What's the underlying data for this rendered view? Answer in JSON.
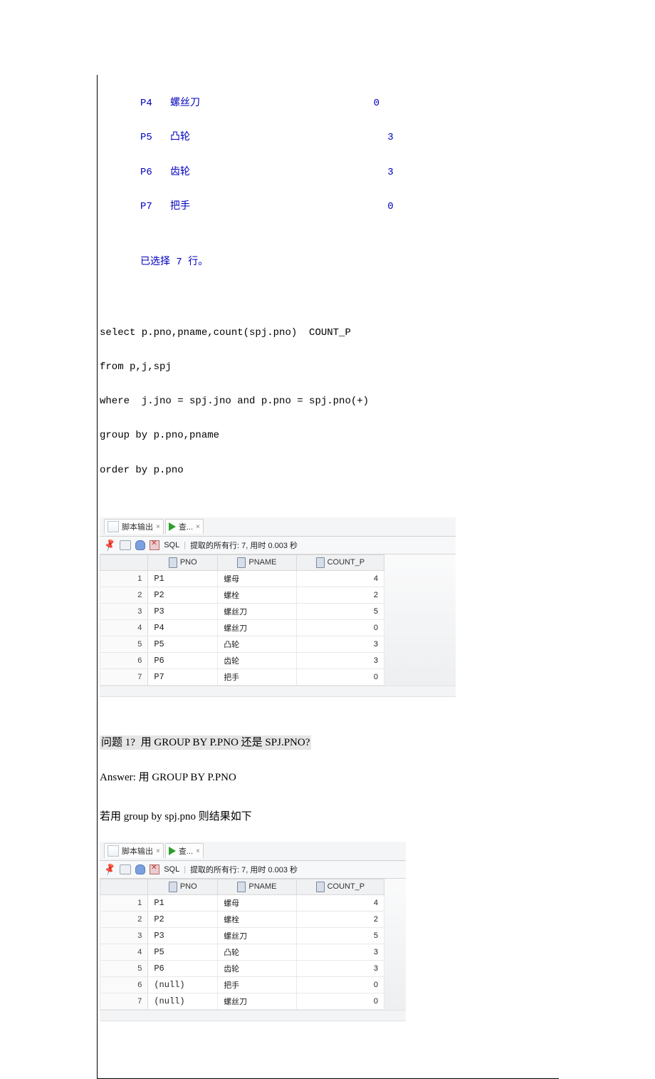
{
  "top_list": [
    {
      "pno": "P4",
      "pname": "螺丝刀",
      "count": "0"
    },
    {
      "pno": "P5",
      "pname": "凸轮",
      "count": "3"
    },
    {
      "pno": "P6",
      "pname": "齿轮",
      "count": "3"
    },
    {
      "pno": "P7",
      "pname": "把手",
      "count": "0"
    }
  ],
  "top_selected_text": "已选择 7 行。",
  "sql_lines": [
    "select p.pno,pname,count(spj.pno)  COUNT_P",
    "from p,j,spj",
    "where  j.jno = spj.jno and p.pno = spj.pno(+)",
    "group by p.pno,pname",
    "order by p.pno"
  ],
  "panel1": {
    "tab1_label": "脚本输出",
    "tab2_label": "查...",
    "sql_word": "SQL",
    "stats": "提取的所有行: 7, 用时 0.003 秒",
    "columns": {
      "pno": "PNO",
      "pname": "PNAME",
      "count": "COUNT_P"
    },
    "rows": [
      {
        "idx": "1",
        "pno": "P1",
        "pname": "螺母",
        "count": "4"
      },
      {
        "idx": "2",
        "pno": "P2",
        "pname": "螺栓",
        "count": "2"
      },
      {
        "idx": "3",
        "pno": "P3",
        "pname": "螺丝刀",
        "count": "5"
      },
      {
        "idx": "4",
        "pno": "P4",
        "pname": "螺丝刀",
        "count": "0"
      },
      {
        "idx": "5",
        "pno": "P5",
        "pname": "凸轮",
        "count": "3"
      },
      {
        "idx": "6",
        "pno": "P6",
        "pname": "齿轮",
        "count": "3"
      },
      {
        "idx": "7",
        "pno": "P7",
        "pname": "把手",
        "count": "0"
      }
    ]
  },
  "question": {
    "label_hl": "问题 1?",
    "label_rest": " 用 GROUP BY P.PNO 还是 SPJ.PNO?",
    "answer": "Answer:  用 GROUP BY P.PNO",
    "note": "若用 group by spj.pno 则结果如下"
  },
  "panel2": {
    "tab1_label": "脚本输出",
    "tab2_label": "查...",
    "sql_word": "SQL",
    "stats": "提取的所有行: 7, 用时 0.003 秒",
    "columns": {
      "pno": "PNO",
      "pname": "PNAME",
      "count": "COUNT_P"
    },
    "rows": [
      {
        "idx": "1",
        "pno": "P1",
        "pname": "螺母",
        "count": "4"
      },
      {
        "idx": "2",
        "pno": "P2",
        "pname": "螺栓",
        "count": "2"
      },
      {
        "idx": "3",
        "pno": "P3",
        "pname": "螺丝刀",
        "count": "5"
      },
      {
        "idx": "4",
        "pno": "P5",
        "pname": "凸轮",
        "count": "3"
      },
      {
        "idx": "5",
        "pno": "P6",
        "pname": "齿轮",
        "count": "3"
      },
      {
        "idx": "6",
        "pno": "(null)",
        "pname": "把手",
        "count": "0"
      },
      {
        "idx": "7",
        "pno": "(null)",
        "pname": "螺丝刀",
        "count": "0"
      }
    ]
  }
}
